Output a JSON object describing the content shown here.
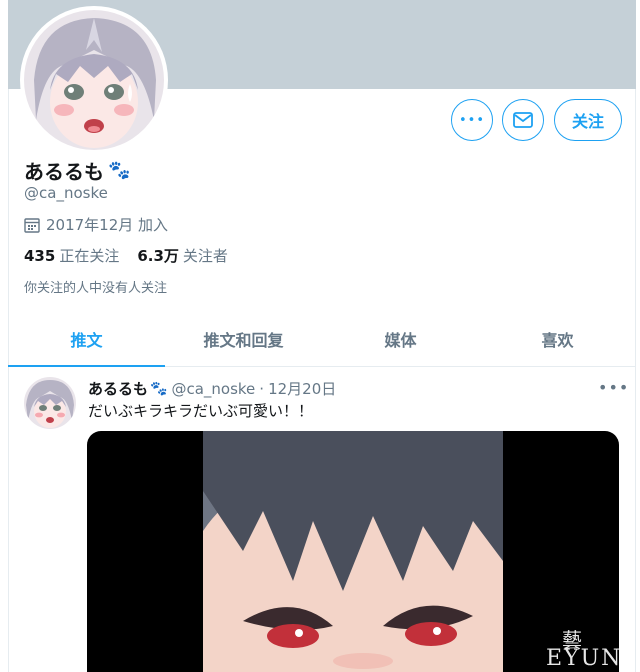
{
  "profile": {
    "display_name": "あるるも",
    "name_emoji": "🐾",
    "handle": "@ca_noske",
    "joined": "2017年12月 加入",
    "following_count": "435",
    "following_label": "正在关注",
    "followers_count": "6.3万",
    "followers_label": "关注者",
    "followed_by_note": "你关注的人中没有人关注"
  },
  "actions": {
    "more_label": "•••",
    "follow_label": "关注"
  },
  "tabs": [
    {
      "label": "推文",
      "active": true
    },
    {
      "label": "推文和回复",
      "active": false
    },
    {
      "label": "媒体",
      "active": false
    },
    {
      "label": "喜欢",
      "active": false
    }
  ],
  "tweet": {
    "name": "あるるも",
    "name_emoji": "🐾",
    "handle": "@ca_noske",
    "separator": "·",
    "date": "12月20日",
    "more_label": "•••",
    "text": "だいぶキラキラだいぶ可愛い！！"
  },
  "watermark": {
    "glyph": "藝",
    "text": "EYUN"
  },
  "colors": {
    "accent": "#1da1f2",
    "banner": "#c5d0d7",
    "muted": "#657786"
  }
}
